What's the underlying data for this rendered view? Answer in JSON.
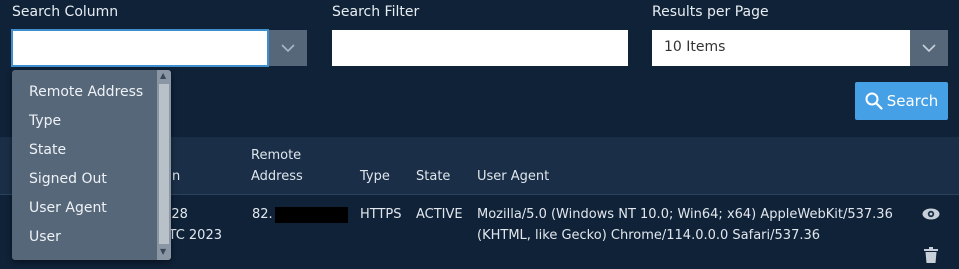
{
  "filters": {
    "search_column_label": "Search Column",
    "search_column_value": "",
    "search_filter_label": "Search Filter",
    "search_filter_value": "",
    "results_label": "Results per Page",
    "results_value": "10 Items",
    "search_button": "Search"
  },
  "dropdown": {
    "options": [
      "Remote Address",
      "Type",
      "State",
      "Signed Out",
      "User Agent",
      "User"
    ]
  },
  "table": {
    "headers": {
      "signed_in_partial": "n",
      "remote_address_1": "Remote",
      "remote_address_2": "Address",
      "type": "Type",
      "state": "State",
      "user_agent": "User Agent"
    },
    "rows": [
      {
        "signed_in_line1": "n 28",
        "signed_in_line2": "UTC 2023",
        "remote_address_prefix": "82.",
        "type": "HTTPS",
        "state": "ACTIVE",
        "user_agent_line1": "Mozilla/5.0 (Windows NT 10.0; Win64; x64) AppleWebKit/537.36",
        "user_agent_line2": "(KHTML, like Gecko) Chrome/114.0.0.0 Safari/537.36"
      }
    ]
  },
  "icons": {
    "chevron": "chevron-down-icon",
    "search": "search-icon",
    "view": "eye-icon",
    "delete": "trash-icon"
  },
  "colors": {
    "background": "#0f2238",
    "accent": "#46a0e6",
    "dropdown": "#56677a"
  }
}
